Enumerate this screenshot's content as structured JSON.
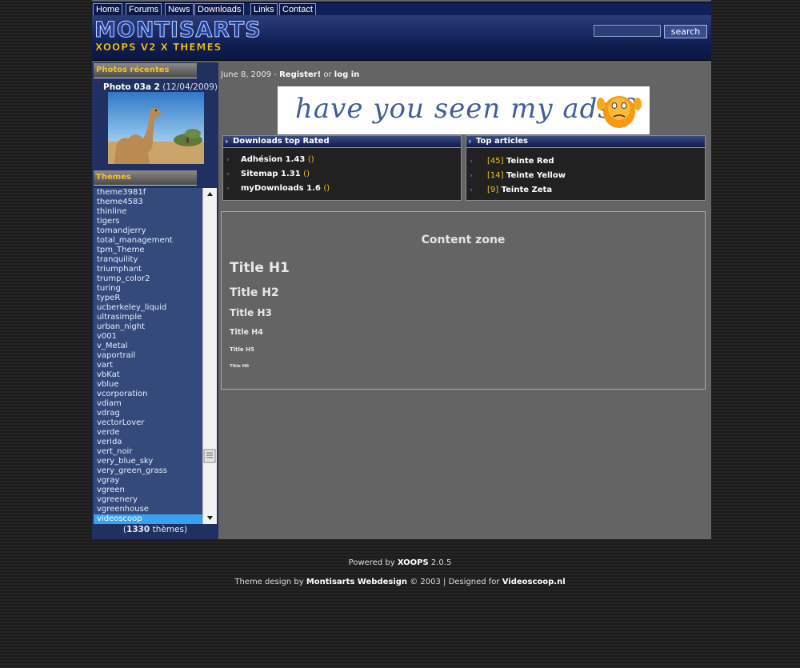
{
  "nav": [
    "Home",
    "Forums",
    "News",
    "Downloads",
    "Links",
    "Contact"
  ],
  "header": {
    "logo": "MONTISARTS",
    "tagline": "XOOPS V2 X THEMES",
    "search_button": "search"
  },
  "photos": {
    "title": "Photos récentes",
    "caption_name": "Photo 03a 2",
    "caption_date": "(12/04/2009)"
  },
  "themes": {
    "title": "Themes",
    "items": [
      "theme3981f",
      "theme4583",
      "thinline",
      "tigers",
      "tomandjerry",
      "total_management",
      "tpm_Theme",
      "tranquility",
      "triumphant",
      "trump_color2",
      "turing",
      "typeR",
      "ucberkeley_liquid",
      "ultrasimple",
      "urban_night",
      "v001",
      "v_Metal",
      "vaportrail",
      "vart",
      "vbKat",
      "vblue",
      "vcorporation",
      "vdiam",
      "vdrag",
      "vectorLover",
      "verde",
      "verida",
      "vert_noir",
      "very_blue_sky",
      "very_green_grass",
      "vgray",
      "vgreen",
      "vgreenery",
      "vgreenhouse",
      "videoscoop"
    ],
    "selected": "videoscoop",
    "count": "1330",
    "count_suffix": " thèmes)",
    "count_prefix": "("
  },
  "datebar": {
    "date": "June 8, 2009 - ",
    "register": "Register!",
    "or": " or ",
    "login": "log in"
  },
  "ad": {
    "text": "have you seen my ads ?"
  },
  "downloads": {
    "title": "Downloads top Rated",
    "items": [
      {
        "name": "Adhésion 1.43",
        "paren": "()"
      },
      {
        "name": "Sitemap 1.31",
        "paren": "()"
      },
      {
        "name": "myDownloads 1.6",
        "paren": "()"
      }
    ]
  },
  "articles": {
    "title": "Top articles",
    "items": [
      {
        "count": "[45]",
        "name": "Teinte Red"
      },
      {
        "count": "[14]",
        "name": "Teinte Yellow"
      },
      {
        "count": "[9]",
        "name": "Teinte Zeta"
      }
    ]
  },
  "content": {
    "title": "Content zone",
    "h1": "Title H1",
    "h2": "Title H2",
    "h3": "Title H3",
    "h4": "Title H4",
    "h5": "Title H5",
    "h6": "Title H6"
  },
  "footer": {
    "powered": "Powered by ",
    "xoops": "XOOPS",
    "version": " 2.0.5",
    "design_prefix": "Theme design by ",
    "designer": "Montisarts Webdesign",
    "mid": " © 2003 | Designed for ",
    "client": "Videoscoop.nl"
  },
  "colors": {
    "accent": "#f5c12a",
    "nav_bg": "#12205a",
    "selected": "#39a2f0"
  }
}
